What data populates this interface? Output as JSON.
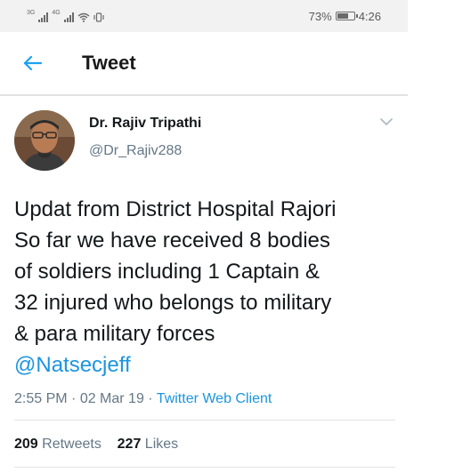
{
  "status_bar": {
    "battery_percent": "73%",
    "battery_level": 0.73,
    "time": "4:26",
    "network_1": "3G",
    "network_2": "4G"
  },
  "header": {
    "title": "Tweet",
    "back_icon": "arrow-left-icon"
  },
  "tweet": {
    "author_name": "Dr. Rajiv Tripathi",
    "author_handle": "@Dr_Rajiv288",
    "text_lines": [
      "Updat from District Hospital Rajori",
      "So far we have received 8 bodies",
      "of soldiers including 1 Captain &",
      "32 injured who belongs to military",
      "& para  military forces"
    ],
    "mention": "@Natsecjeff",
    "time": "2:55 PM",
    "date": "02 Mar 19",
    "client": "Twitter Web Client",
    "separator": " · ",
    "retweets_count": "209",
    "retweets_label": "Retweets",
    "likes_count": "227",
    "likes_label": "Likes"
  },
  "colors": {
    "accent": "#1b95e0",
    "secondary_text": "#657786",
    "primary_text": "#14171a"
  }
}
